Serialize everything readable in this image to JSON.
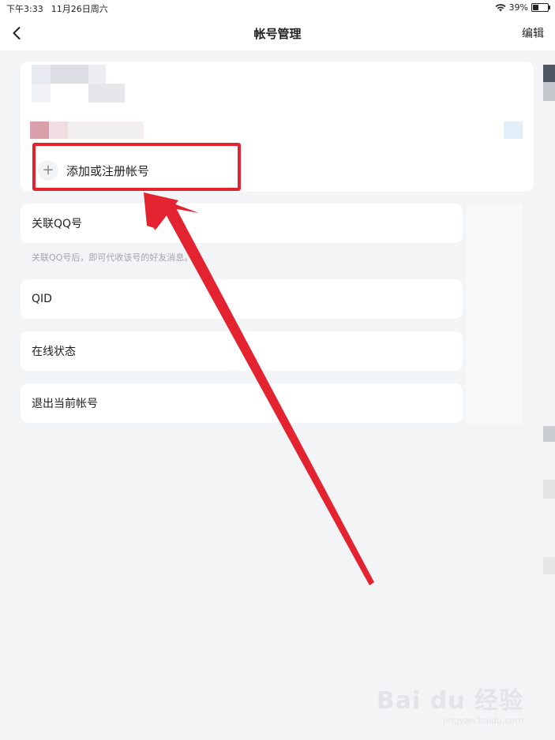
{
  "status_bar": {
    "time": "下午3:33",
    "date": "11月26日周六",
    "battery": "39%",
    "battery_level": 0.39
  },
  "nav": {
    "title": "帐号管理",
    "edit_label": "编辑"
  },
  "account_card": {
    "add_account_label": "添加或注册帐号",
    "plus_symbol": "+"
  },
  "settings": {
    "link_qq_label": "关联QQ号",
    "link_qq_hint": "关联QQ号后，即可代收该号的好友消息。",
    "qid_label": "QID",
    "online_status_label": "在线状态",
    "logout_label": "退出当前帐号"
  },
  "watermark": {
    "main": "Bai du 经验",
    "sub": "jingyan.baidu.com"
  },
  "colors": {
    "highlight": "#e32330",
    "background": "#f3f4f6"
  }
}
